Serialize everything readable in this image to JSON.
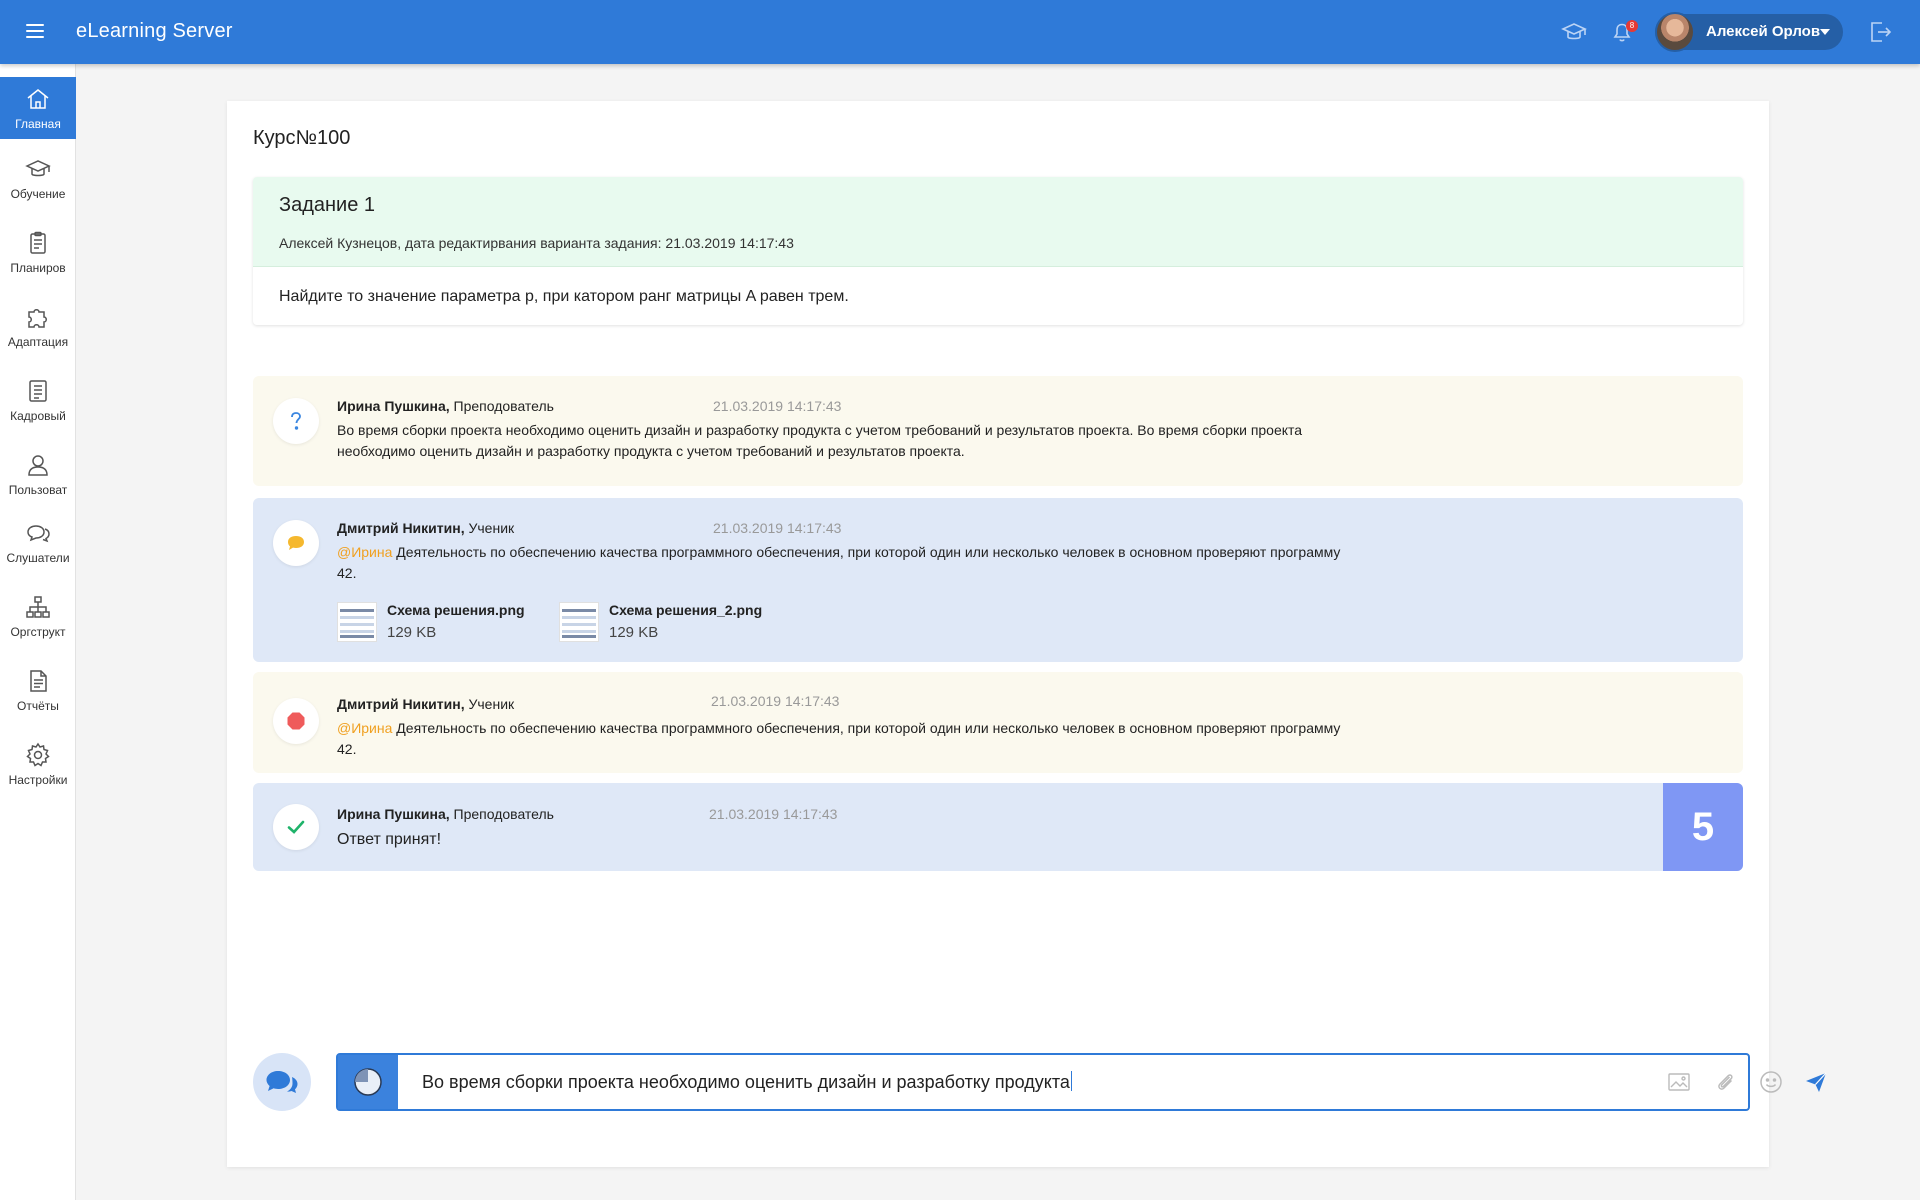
{
  "app": {
    "title": "eLearning Server",
    "notifications_count": "8"
  },
  "user": {
    "name": "Алексей Орлов"
  },
  "sidebar": {
    "items": [
      {
        "label": "Главная",
        "icon": "home-icon"
      },
      {
        "label": "Обучение",
        "icon": "graduation-cap-icon"
      },
      {
        "label": "Планиров",
        "icon": "clipboard-icon"
      },
      {
        "label": "Адаптация",
        "icon": "puzzle-icon"
      },
      {
        "label": "Кадровый",
        "icon": "document-list-icon"
      },
      {
        "label": "Пользоват",
        "icon": "user-icon"
      },
      {
        "label": "Слушатели",
        "icon": "chat-bubbles-icon"
      },
      {
        "label": "Оргструкт",
        "icon": "org-chart-icon"
      },
      {
        "label": "Отчёты",
        "icon": "report-icon"
      },
      {
        "label": "Настройки",
        "icon": "gear-icon"
      }
    ]
  },
  "course": {
    "title": "Курс№100"
  },
  "task": {
    "title": "Задание 1",
    "meta": "Алексей Кузнецов, дата редактирвания варианта задания: 21.03.2019 14:17:43",
    "body": "Найдите то значение параметра p, при катором ранг матрицы A равен трем."
  },
  "messages": [
    {
      "author": "Ирина Пушкина,",
      "role": " Преподователь",
      "time": "21.03.2019 14:17:43",
      "icon": "question-icon",
      "text": "Во время сборки проекта необходимо оценить дизайн и разработку продукта с учетом требований и результатов проекта. Во время сборки проекта необходимо оценить дизайн и разработку продукта с учетом требований и результатов проекта."
    },
    {
      "author": "Дмитрий Никитин,",
      "role": " Ученик",
      "time": "21.03.2019 14:17:43",
      "icon": "comment-icon",
      "mention": "@Ирина",
      "text": " Деятельность по обеспечению качества программного обеспечения, при которой один или несколько человек в основном проверяют программу 42.",
      "attachments": [
        {
          "name": "Схема решения.png",
          "size": "129 KB"
        },
        {
          "name": "Схема решения_2.png",
          "size": "129 KB"
        }
      ]
    },
    {
      "author": "Дмитрий Никитин,",
      "role": " Ученик",
      "time": "21.03.2019 14:17:43",
      "icon": "stop-icon",
      "mention": "@Ирина",
      "text": " Деятельность по обеспечению качества программного обеспечения, при которой один или несколько человек в основном проверяют программу 42."
    },
    {
      "author": "Ирина Пушкина,",
      "role": " Преподователь",
      "time": "21.03.2019 14:17:43",
      "icon": "check-icon",
      "text": "Ответ принят!",
      "grade": "5"
    }
  ],
  "composer": {
    "value": "Во время сборки проекта необходимо оценить дизайн и разработку продукта"
  },
  "colors": {
    "brand": "#2f7ad8",
    "task_header": "#e8faef",
    "message_yellow": "#fbf9ee",
    "message_blue": "#dfe8f7",
    "grade": "#7f97f4",
    "mention": "#f0a020"
  }
}
